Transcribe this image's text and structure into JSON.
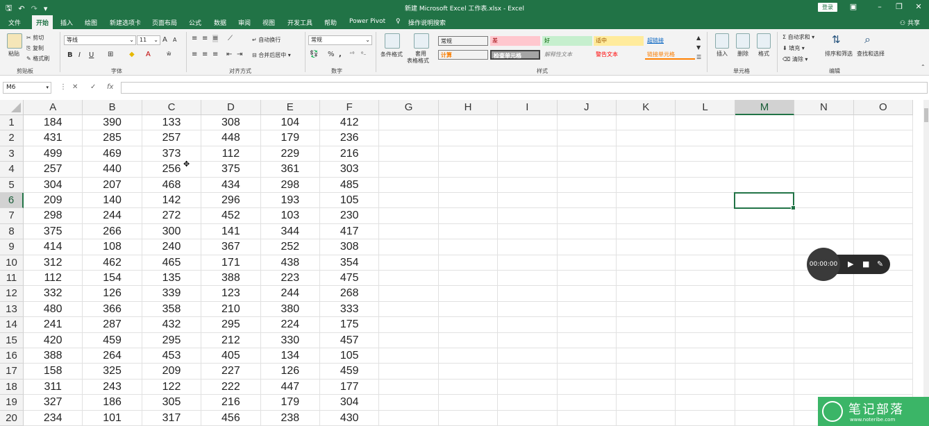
{
  "titlebar": {
    "title": "新建 Microsoft Excel 工作表.xlsx  -  Excel",
    "login_label": "登录",
    "qat": [
      "save-icon",
      "undo-icon",
      "redo-icon",
      "customize-icon"
    ]
  },
  "tabs": [
    "文件",
    "开始",
    "插入",
    "绘图",
    "新建选项卡",
    "页面布局",
    "公式",
    "数据",
    "审阅",
    "视图",
    "开发工具",
    "帮助",
    "Power Pivot",
    "操作说明搜索"
  ],
  "active_tab": "开始",
  "share_label": "共享",
  "ribbon": {
    "clipboard": {
      "paste": "粘贴",
      "cut": "剪切",
      "copy": "复制",
      "format_painter": "格式刷",
      "group": "剪贴板"
    },
    "font": {
      "name": "等线",
      "size": "11",
      "group": "字体",
      "bold": "B",
      "italic": "I",
      "underline": "U",
      "grow": "A",
      "shrink": "A"
    },
    "alignment": {
      "wrap": "自动换行",
      "merge": "合并后居中",
      "group": "对齐方式"
    },
    "number": {
      "format": "常规",
      "percent": "%",
      "comma": ",",
      "group": "数字"
    },
    "styles": {
      "conditional": "条件格式",
      "table": "套用",
      "table2": "表格格式",
      "cells": [
        {
          "label": "常规",
          "bg": "#ffffff",
          "fg": "#000000"
        },
        {
          "label": "差",
          "bg": "#ffc7ce",
          "fg": "#9c0006"
        },
        {
          "label": "好",
          "bg": "#c6efce",
          "fg": "#006100"
        },
        {
          "label": "适中",
          "bg": "#ffeb9c",
          "fg": "#9c5700"
        },
        {
          "label": "超链接",
          "bg": "#ffffff",
          "fg": "#0563c1"
        },
        {
          "label": "计算",
          "bg": "#f2f2f2",
          "fg": "#fa7d00"
        },
        {
          "label": "检查单元格",
          "bg": "#a5a5a5",
          "fg": "#ffffff"
        },
        {
          "label": "解释性文本",
          "bg": "#ffffff",
          "fg": "#7f7f7f"
        },
        {
          "label": "警告文本",
          "bg": "#ffffff",
          "fg": "#ff0000"
        },
        {
          "label": "链接单元格",
          "bg": "#ffffff",
          "fg": "#fa7d00"
        }
      ],
      "group": "样式"
    },
    "cells_group": {
      "insert": "插入",
      "delete": "删除",
      "format": "格式",
      "group": "单元格"
    },
    "editing": {
      "autosum": "自动求和",
      "fill": "填充",
      "clear": "清除",
      "sort": "排序和筛选",
      "find": "查找和选择",
      "group": "编辑"
    }
  },
  "formula_bar": {
    "name_box": "M6",
    "cancel": "✕",
    "enter": "✓",
    "fx": "fx",
    "value": ""
  },
  "grid": {
    "columns": [
      "A",
      "B",
      "C",
      "D",
      "E",
      "F",
      "G",
      "H",
      "I",
      "J",
      "K",
      "L",
      "M",
      "N",
      "O"
    ],
    "selected_col": "M",
    "selected_row": 6,
    "rows": [
      {
        "n": "1",
        "cells": [
          "184",
          "390",
          "133",
          "308",
          "104",
          "412"
        ]
      },
      {
        "n": "2",
        "cells": [
          "431",
          "285",
          "257",
          "448",
          "179",
          "236"
        ]
      },
      {
        "n": "3",
        "cells": [
          "499",
          "469",
          "373",
          "112",
          "229",
          "216"
        ]
      },
      {
        "n": "4",
        "cells": [
          "257",
          "440",
          "256",
          "375",
          "361",
          "303"
        ]
      },
      {
        "n": "5",
        "cells": [
          "304",
          "207",
          "468",
          "434",
          "298",
          "485"
        ]
      },
      {
        "n": "6",
        "cells": [
          "209",
          "140",
          "142",
          "296",
          "193",
          "105"
        ]
      },
      {
        "n": "7",
        "cells": [
          "298",
          "244",
          "272",
          "452",
          "103",
          "230"
        ]
      },
      {
        "n": "8",
        "cells": [
          "375",
          "266",
          "300",
          "141",
          "344",
          "417"
        ]
      },
      {
        "n": "9",
        "cells": [
          "414",
          "108",
          "240",
          "367",
          "252",
          "308"
        ]
      },
      {
        "n": "10",
        "cells": [
          "312",
          "462",
          "465",
          "171",
          "438",
          "354"
        ]
      },
      {
        "n": "11",
        "cells": [
          "112",
          "154",
          "135",
          "388",
          "223",
          "475"
        ]
      },
      {
        "n": "12",
        "cells": [
          "332",
          "126",
          "339",
          "123",
          "244",
          "268"
        ]
      },
      {
        "n": "13",
        "cells": [
          "480",
          "366",
          "358",
          "210",
          "380",
          "333"
        ]
      },
      {
        "n": "14",
        "cells": [
          "241",
          "287",
          "432",
          "295",
          "224",
          "175"
        ]
      },
      {
        "n": "15",
        "cells": [
          "420",
          "459",
          "295",
          "212",
          "330",
          "457"
        ]
      },
      {
        "n": "16",
        "cells": [
          "388",
          "264",
          "453",
          "405",
          "134",
          "105"
        ]
      },
      {
        "n": "17",
        "cells": [
          "158",
          "325",
          "209",
          "227",
          "126",
          "459"
        ]
      },
      {
        "n": "18",
        "cells": [
          "311",
          "243",
          "122",
          "222",
          "447",
          "177"
        ]
      },
      {
        "n": "19",
        "cells": [
          "327",
          "186",
          "305",
          "216",
          "179",
          "304"
        ]
      },
      {
        "n": "20",
        "cells": [
          "234",
          "101",
          "317",
          "456",
          "238",
          "430"
        ]
      }
    ]
  },
  "recorder": {
    "time": "00:00:00"
  },
  "watermark": {
    "text": "笔记部落",
    "url": "www.noteribe.com"
  }
}
